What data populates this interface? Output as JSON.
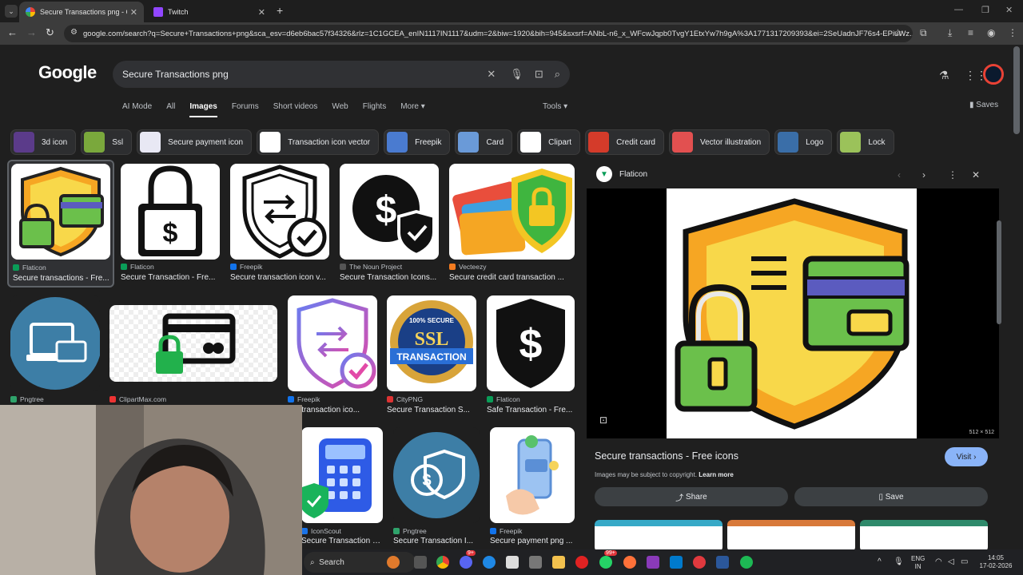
{
  "browser": {
    "tabs": [
      {
        "label": "Secure Transactions png - Goog",
        "active": true
      },
      {
        "label": "Twitch",
        "active": false
      }
    ],
    "url": "google.com/search?q=Secure+Transactions+png&sca_esv=d6eb6bac57f34326&rlz=1C1GCEA_enIN1117IN1117&udm=2&biw=1920&bih=945&sxsrf=ANbL-n6_x_WFcwJqpb0TvgY1EtxYw7h9gA%3A1771317209393&ei=2SeUadnJF76s4-EPiuWz..."
  },
  "search": {
    "logo": "Google",
    "query": "Secure Transactions png",
    "tabs": [
      "AI Mode",
      "All",
      "Images",
      "Forums",
      "Short videos",
      "Web",
      "Flights",
      "More"
    ],
    "active_tab": "Images",
    "tools_label": "Tools",
    "saves_label": "Saves"
  },
  "chips": [
    "3d icon",
    "Ssl",
    "Secure payment icon",
    "Transaction icon vector",
    "Freepik",
    "Card",
    "Clipart",
    "Credit card",
    "Vector illustration",
    "Logo",
    "Lock"
  ],
  "results": [
    {
      "source": "Flaticon",
      "title": "Secure transactions - Fre..."
    },
    {
      "source": "Flaticon",
      "title": "Secure Transaction - Fre..."
    },
    {
      "source": "Freepik",
      "title": "Secure transaction icon v..."
    },
    {
      "source": "The Noun Project",
      "title": "Secure Transaction Icons..."
    },
    {
      "source": "Vecteezy",
      "title": "Secure credit card transaction ..."
    },
    {
      "source": "Pngtree",
      "title": ""
    },
    {
      "source": "ClipartMax.com",
      "title": ""
    },
    {
      "source": "Freepik",
      "title": "ure transaction ico..."
    },
    {
      "source": "CityPNG",
      "title": "Secure Transaction S..."
    },
    {
      "source": "Flaticon",
      "title": "Safe Transaction - Fre..."
    },
    {
      "source": "IconScout",
      "title": "Secure Transaction 3..."
    },
    {
      "source": "Pngtree",
      "title": "Secure Transaction I..."
    },
    {
      "source": "Freepik",
      "title": "Secure payment png ..."
    }
  ],
  "ssl_badge": {
    "top": "100% SECURE",
    "mid": "SSL",
    "bottom": "TRANSACTION"
  },
  "panel": {
    "source": "Flaticon",
    "dimensions": "512 × 512",
    "title": "Secure transactions - Free icons",
    "visit_label": "Visit",
    "copyright_note": "Images may be subject to copyright.",
    "learn_more": "Learn more",
    "share_label": "Share",
    "save_label": "Save"
  },
  "taskbar": {
    "search_label": "Search",
    "lang": "ENG",
    "region": "IN",
    "time": "14:05",
    "date": "17-02-2026",
    "badge_discord": "9+",
    "badge_whatsapp": "99+"
  },
  "colors": {
    "accent": "#8ab4f8",
    "background": "#1f1f1f",
    "chip": "#2d2e30"
  }
}
